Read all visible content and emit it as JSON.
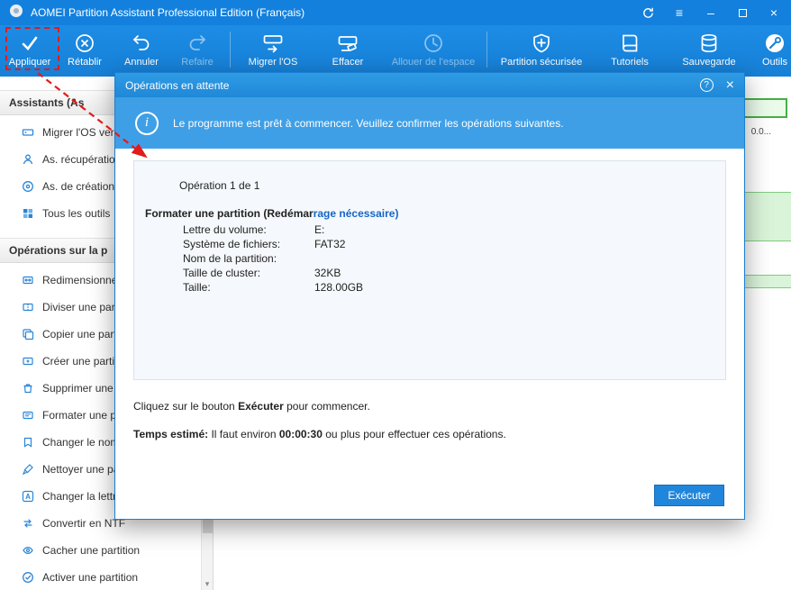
{
  "window": {
    "title": "AOMEI Partition Assistant Professional Edition (Français)",
    "controls": {
      "menu_glyph": "≡",
      "minimize_glyph": "–",
      "close_glyph": "×"
    }
  },
  "toolbar": {
    "items": [
      {
        "label": "Appliquer",
        "icon": "check-icon",
        "disabled": false
      },
      {
        "label": "Rétablir",
        "icon": "discard-circle-icon",
        "disabled": false
      },
      {
        "label": "Annuler",
        "icon": "undo-icon",
        "disabled": false
      },
      {
        "label": "Refaire",
        "icon": "redo-icon",
        "disabled": true
      },
      {
        "label": "Migrer l'OS",
        "icon": "migrate-os-icon",
        "disabled": false
      },
      {
        "label": "Effacer",
        "icon": "wipe-disk-icon",
        "disabled": false
      },
      {
        "label": "Allouer de l'espace",
        "icon": "clock-icon",
        "disabled": true
      },
      {
        "label": "Partition sécurisée",
        "icon": "shield-plus-icon",
        "disabled": false
      },
      {
        "label": "Tutoriels",
        "icon": "book-icon",
        "disabled": false
      },
      {
        "label": "Sauvegarde",
        "icon": "database-icon",
        "disabled": false
      },
      {
        "label": "Outils",
        "icon": "wrench-icon",
        "disabled": false
      }
    ]
  },
  "sidebar": {
    "sections": [
      {
        "title": "Assistants (As",
        "items": [
          {
            "label": "Migrer l'OS vers",
            "icon": "migrate-os-icon"
          },
          {
            "label": "As. récupération",
            "icon": "recovery-icon"
          },
          {
            "label": "As. de création d",
            "icon": "bootable-media-icon"
          },
          {
            "label": "Tous les outils",
            "icon": "all-tools-icon"
          }
        ]
      },
      {
        "title": "Opérations sur la p",
        "items": [
          {
            "label": "Redimensionner",
            "icon": "resize-icon"
          },
          {
            "label": "Diviser une parti",
            "icon": "split-icon"
          },
          {
            "label": "Copier une parti",
            "icon": "copy-icon"
          },
          {
            "label": "Créer une partiti",
            "icon": "create-icon"
          },
          {
            "label": "Supprimer une p",
            "icon": "delete-icon"
          },
          {
            "label": "Formater une pa",
            "icon": "format-icon"
          },
          {
            "label": "Changer le nom",
            "icon": "rename-icon"
          },
          {
            "label": "Nettoyer une pa",
            "icon": "clean-icon"
          },
          {
            "label": "Changer la lettre",
            "icon": "drive-letter-icon"
          },
          {
            "label": "Convertir en NTF",
            "icon": "convert-icon"
          },
          {
            "label": "Cacher une partition",
            "icon": "hide-icon"
          },
          {
            "label": "Activer une partition",
            "icon": "activate-icon"
          }
        ]
      }
    ]
  },
  "dialog": {
    "title": "Opérations en attente",
    "help_glyph": "?",
    "close_glyph": "×",
    "banner_text": "Le programme est prêt à commencer. Veuillez confirmer les opérations suivantes.",
    "operation_counter": "Opération 1 de 1",
    "operation_name": "Formater une partition",
    "operation_note": {
      "prefix": " (Redémar",
      "highlight": "rage nécessaire",
      "suffix": ")"
    },
    "details": [
      {
        "label": "Lettre du volume:",
        "value": "E:"
      },
      {
        "label": "Système de fichiers:",
        "value": "FAT32"
      },
      {
        "label": "Nom de la partition:",
        "value": ""
      },
      {
        "label": "Taille de cluster:",
        "value": "32KB"
      },
      {
        "label": "Taille:",
        "value": "128.00GB"
      }
    ],
    "instruction": {
      "pre": "Cliquez sur le bouton ",
      "bold": "Exécuter",
      "post": " pour commencer."
    },
    "estimate": {
      "label": "Temps estimé:",
      "pre": " Il faut environ ",
      "time": "00:00:30",
      "post": " ou plus pour effectuer ces opérations."
    },
    "execute_button": "Exécuter"
  },
  "disk_panel": {
    "fragment_text": "0.0..."
  }
}
